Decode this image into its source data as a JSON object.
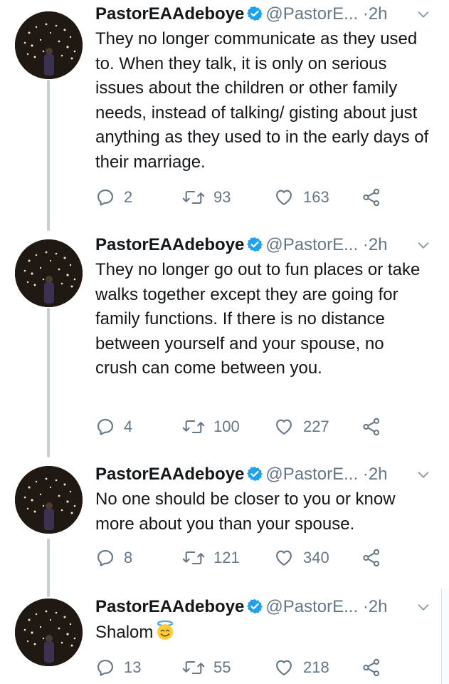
{
  "tweets": [
    {
      "name": "PastorEAAdeboye",
      "handle": "@PastorE...",
      "dot": "·",
      "time": "2h",
      "text": "They no longer communicate as they used to. When they talk, it is only on serious issues about the children or other family needs, instead of talking/ gisting about just anything as they used to in the early days of their marriage.",
      "replies": "2",
      "retweets": "93",
      "likes": "163"
    },
    {
      "name": "PastorEAAdeboye",
      "handle": "@PastorE...",
      "dot": "·",
      "time": "2h",
      "text": "They no longer go out to fun places or take walks together except they are going for family functions. If there is no distance between yourself and your spouse, no crush can come between you.",
      "replies": "4",
      "retweets": "100",
      "likes": "227"
    },
    {
      "name": "PastorEAAdeboye",
      "handle": "@PastorE...",
      "dot": "·",
      "time": "2h",
      "text": "No one should be closer to you or know more about you than your spouse.",
      "replies": "8",
      "retweets": "121",
      "likes": "340"
    },
    {
      "name": "PastorEAAdeboye",
      "handle": "@PastorE...",
      "dot": "·",
      "time": "2h",
      "text": "Shalom",
      "replies": "13",
      "retweets": "55",
      "likes": "218"
    }
  ],
  "icons": {
    "verified": "verified-badge-icon",
    "caret": "chevron-down-icon",
    "reply": "reply-icon",
    "retweet": "retweet-icon",
    "like": "heart-icon",
    "share": "share-icon",
    "emoji": "smiling-face-with-halo-emoji"
  },
  "colors": {
    "text": "#14171a",
    "secondary": "#657786",
    "verified": "#1da1f2",
    "thread_line": "#c4cfd6"
  }
}
